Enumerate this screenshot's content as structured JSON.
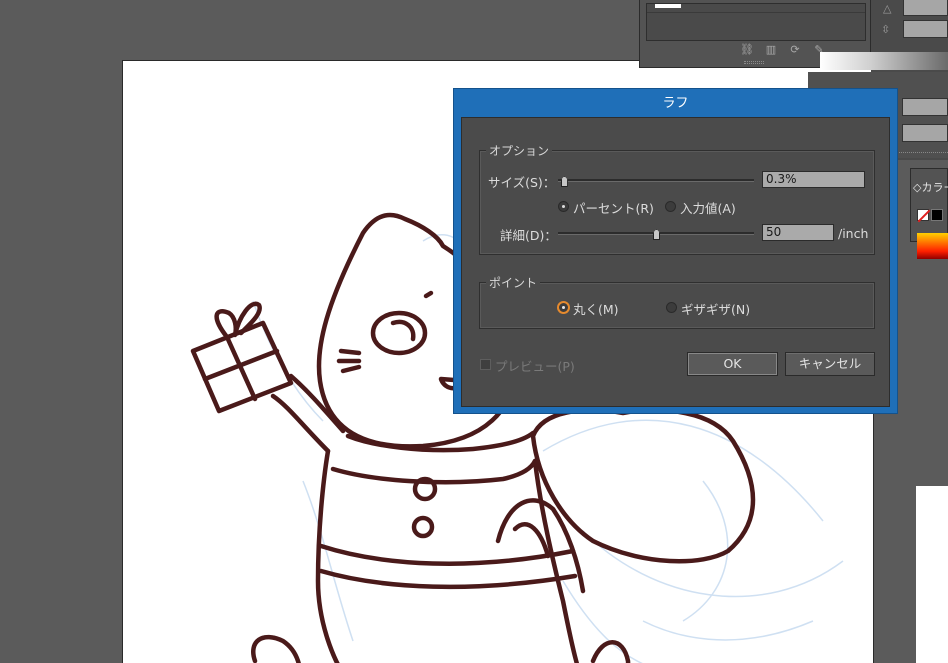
{
  "dialog": {
    "title": "ラフ",
    "options_group": "オプション",
    "size_label": "サイズ(S)：",
    "size_value": "0.3%",
    "size_slider_fraction": 0.03,
    "percent_label": "パーセント(R)",
    "absolute_label": "入力値(A)",
    "detail_label": "詳細(D)：",
    "detail_value": "50",
    "detail_unit": "/inch",
    "detail_slider_fraction": 0.5,
    "points_group": "ポイント",
    "smooth_label": "丸く(M)",
    "corner_label": "ギザギザ(N)",
    "preview_label": "プレビュー(P)",
    "ok_label": "OK",
    "cancel_label": "キャンセル"
  },
  "color_panel": {
    "tab_label": "◇カラー"
  },
  "colors": {
    "dialog_frame": "#1f6fb8",
    "line_art": "#4a1a1a",
    "sketch": "#c9ddf0"
  }
}
